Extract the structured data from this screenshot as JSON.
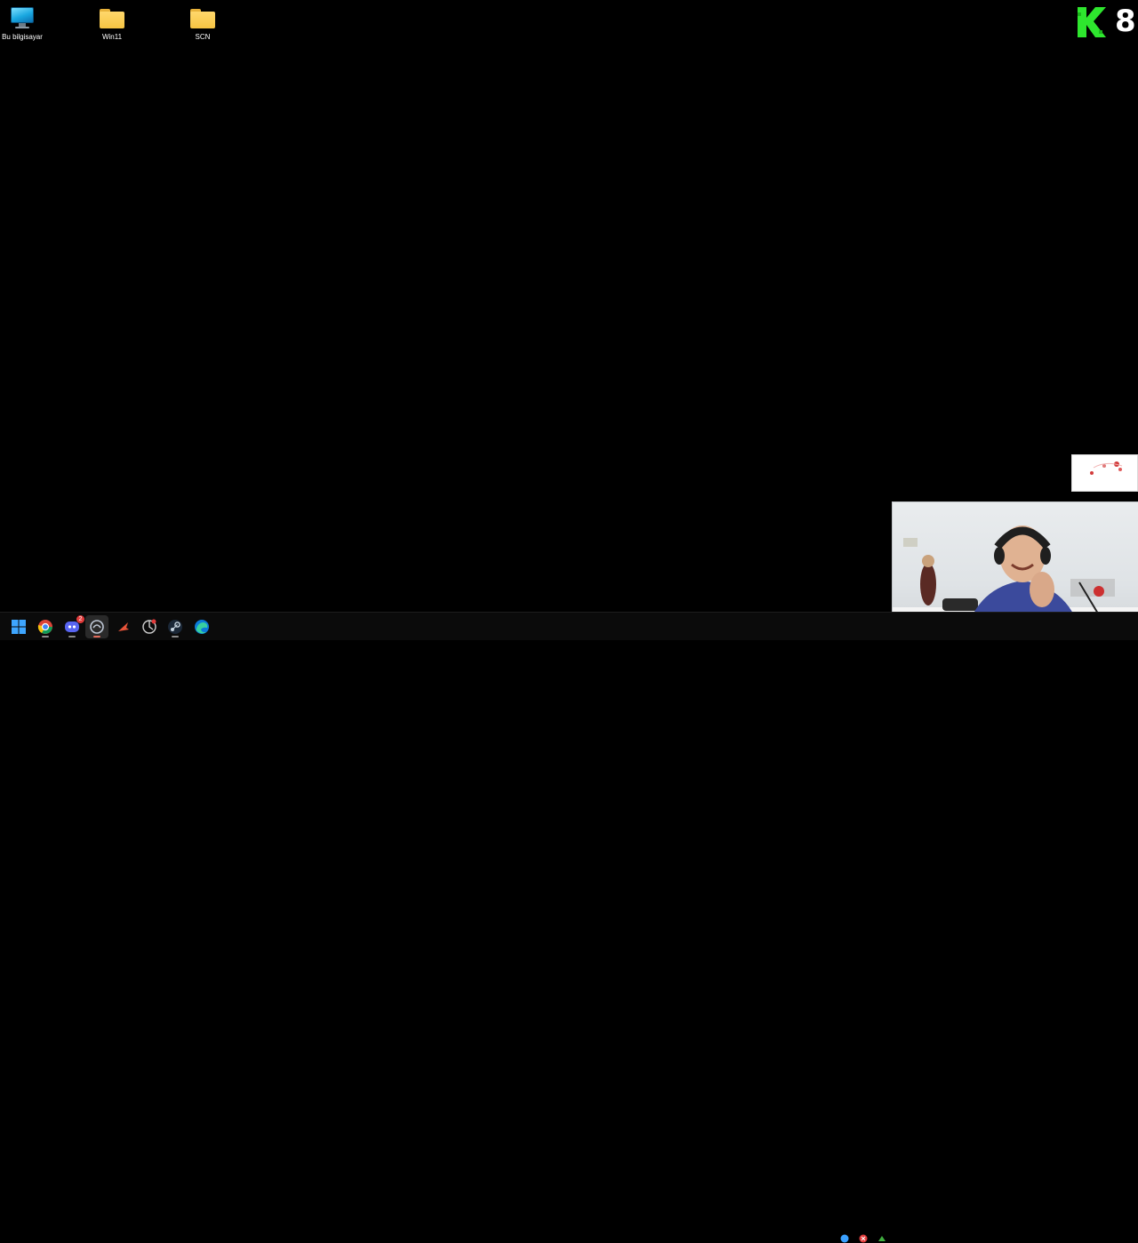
{
  "desktop": {
    "icons": [
      {
        "label": "Bu bilgisayar",
        "icon": "computer-icon"
      },
      {
        "label": "Win11",
        "icon": "folder-icon"
      },
      {
        "label": "SCN",
        "icon": "folder-icon"
      }
    ]
  },
  "overlay": {
    "logo_letter_icon": "k-logo-icon",
    "logo_number": "8",
    "logo_color": "#2ee62e"
  },
  "taskbar": {
    "items": [
      {
        "icon": "windows-start-icon"
      },
      {
        "icon": "chrome-icon"
      },
      {
        "icon": "discord-icon",
        "badge": "2"
      },
      {
        "icon": "app-icon",
        "active": true
      },
      {
        "icon": "game-app-icon"
      },
      {
        "icon": "browser-icon"
      },
      {
        "icon": "steam-icon"
      },
      {
        "icon": "edge-icon"
      }
    ],
    "tray": [
      {
        "icon": "tray-blue-icon",
        "color": "#3aa0ff"
      },
      {
        "icon": "tray-red-icon",
        "color": "#e23b3b"
      },
      {
        "icon": "tray-green-icon",
        "color": "#3fae3f"
      }
    ]
  }
}
